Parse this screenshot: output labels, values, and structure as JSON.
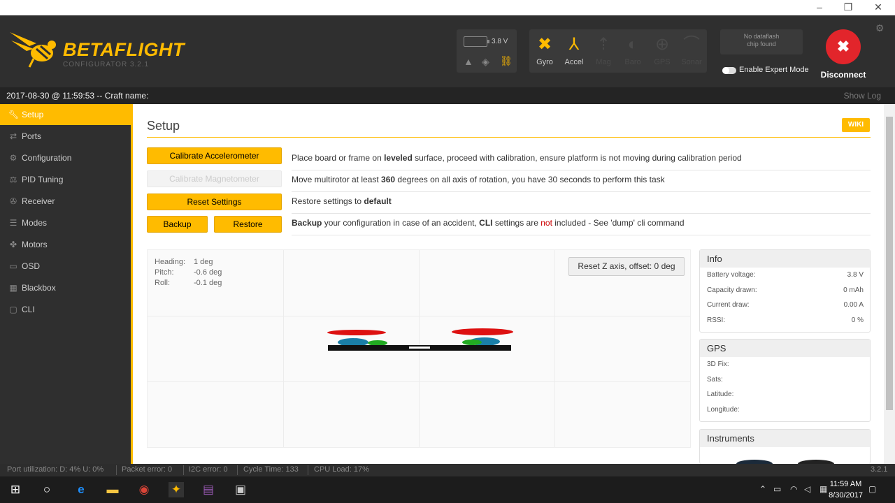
{
  "app": {
    "logo_text": "BETAFLIGHT",
    "logo_sub": "CONFIGURATOR 3.2.1"
  },
  "window_controls": {
    "minimize": "–",
    "restore": "❐",
    "close": "✕"
  },
  "header": {
    "battery_voltage": "3.8 V",
    "sensors": [
      {
        "label": "Gyro",
        "active": true,
        "icon": "gyro-icon"
      },
      {
        "label": "Accel",
        "active": true,
        "icon": "accel-icon"
      },
      {
        "label": "Mag",
        "active": false,
        "icon": "mag-icon"
      },
      {
        "label": "Baro",
        "active": false,
        "icon": "baro-icon"
      },
      {
        "label": "GPS",
        "active": false,
        "icon": "gps-icon"
      },
      {
        "label": "Sonar",
        "active": false,
        "icon": "sonar-icon"
      }
    ],
    "dataflash_line1": "No dataflash",
    "dataflash_line2": "chip found",
    "expert_mode_label": "Enable Expert Mode",
    "expert_mode_enabled": false,
    "disconnect_label": "Disconnect"
  },
  "log": {
    "text": "2017-08-30 @ 11:59:53 -- Craft name:",
    "show_log": "Show Log"
  },
  "sidebar": {
    "items": [
      {
        "label": "Setup",
        "icon": "wrench-icon",
        "active": true
      },
      {
        "label": "Ports",
        "icon": "ports-icon",
        "active": false
      },
      {
        "label": "Configuration",
        "icon": "gear-icon",
        "active": false
      },
      {
        "label": "PID Tuning",
        "icon": "pid-icon",
        "active": false
      },
      {
        "label": "Receiver",
        "icon": "receiver-icon",
        "active": false
      },
      {
        "label": "Modes",
        "icon": "modes-icon",
        "active": false
      },
      {
        "label": "Motors",
        "icon": "motors-icon",
        "active": false
      },
      {
        "label": "OSD",
        "icon": "osd-icon",
        "active": false
      },
      {
        "label": "Blackbox",
        "icon": "blackbox-icon",
        "active": false
      },
      {
        "label": "CLI",
        "icon": "cli-icon",
        "active": false
      }
    ]
  },
  "setup": {
    "title": "Setup",
    "wiki": "WIKI",
    "calibrate_acc": "Calibrate Accelerometer",
    "calibrate_acc_text": {
      "before": "Place board or frame on ",
      "bold": "leveled",
      "after": " surface, proceed with calibration, ensure platform is not moving during calibration period"
    },
    "calibrate_mag": "Calibrate Magnetometer",
    "calibrate_mag_text": {
      "before": "Move multirotor at least ",
      "bold": "360",
      "after": " degrees on all axis of rotation, you have 30 seconds to perform this task"
    },
    "reset_settings": "Reset Settings",
    "reset_text": {
      "before": "Restore settings to ",
      "bold": "default"
    },
    "backup": "Backup",
    "restore": "Restore",
    "backup_text": {
      "bold1": "Backup",
      "mid1": " your configuration in case of an accident, ",
      "bold2": "CLI",
      "mid2": " settings are ",
      "red": "not",
      "after": " included - See 'dump' cli command"
    },
    "attitude": {
      "heading_label": "Heading:",
      "heading_value": "1 deg",
      "pitch_label": "Pitch:",
      "pitch_value": "-0.6 deg",
      "roll_label": "Roll:",
      "roll_value": "-0.1 deg"
    },
    "reset_z": "Reset Z axis, offset: 0 deg"
  },
  "info": {
    "title": "Info",
    "rows": [
      {
        "label": "Battery voltage:",
        "value": "3.8 V"
      },
      {
        "label": "Capacity drawn:",
        "value": "0 mAh"
      },
      {
        "label": "Current draw:",
        "value": "0.00 A"
      },
      {
        "label": "RSSI:",
        "value": "0 %"
      }
    ]
  },
  "gps": {
    "title": "GPS",
    "rows": [
      {
        "label": "3D Fix:",
        "value": ""
      },
      {
        "label": "Sats:",
        "value": ""
      },
      {
        "label": "Latitude:",
        "value": ""
      },
      {
        "label": "Longitude:",
        "value": ""
      }
    ]
  },
  "instruments": {
    "title": "Instruments"
  },
  "status": {
    "port_util": "Port utilization: D: 4% U: 0%",
    "packet_error": "Packet error: 0",
    "i2c_error": "I2C error: 0",
    "cycle_time": "Cycle Time: 133",
    "cpu_load": "CPU Load: 17%",
    "version": "3.2.1"
  },
  "taskbar": {
    "time": "11:59 AM",
    "date": "8/30/2017"
  },
  "colors": {
    "accent": "#ffbb00",
    "disconnect": "#e2252b",
    "header": "#2f2f2f"
  }
}
